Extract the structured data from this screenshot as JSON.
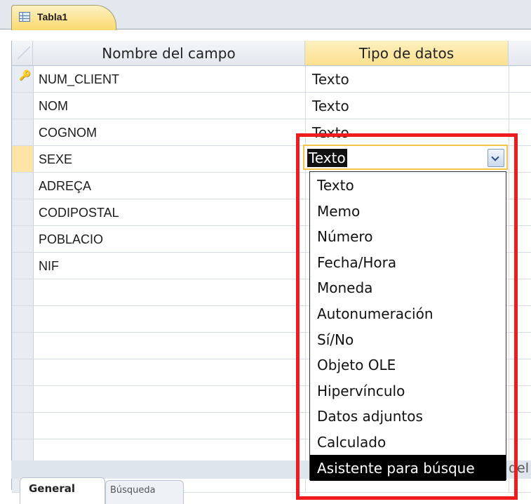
{
  "tab": {
    "label": "Tabla1",
    "icon": "table-icon"
  },
  "grid": {
    "header": {
      "field_name": "Nombre del campo",
      "data_type": "Tipo de datos"
    },
    "rows": [
      {
        "name": "NUM_CLIENT",
        "type": "Texto",
        "key": true
      },
      {
        "name": "NOM",
        "type": "Texto"
      },
      {
        "name": "COGNOM",
        "type": "Texto"
      },
      {
        "name": "SEXE",
        "type": "Texto",
        "current": true
      },
      {
        "name": "ADREÇA",
        "type": ""
      },
      {
        "name": "CODIPOSTAL",
        "type": ""
      },
      {
        "name": "POBLACIO",
        "type": ""
      },
      {
        "name": "NIF",
        "type": ""
      }
    ]
  },
  "combo": {
    "value": "Texto",
    "button_icon": "chevron-down-icon"
  },
  "dropdown": {
    "options": [
      "Texto",
      "Memo",
      "Número",
      "Fecha/Hora",
      "Moneda",
      "Autonumeración",
      "Sí/No",
      "Objeto OLE",
      "Hipervínculo",
      "Datos adjuntos",
      "Calculado",
      "Asistente para búsque"
    ],
    "highlighted": "Asistente para búsque"
  },
  "lower": {
    "general_tab": "General",
    "lookup_tab": "Búsqueda",
    "partial": "del"
  },
  "colors": {
    "highlight_border": "#ee1c1c",
    "header_selected": "#fbe08f",
    "current_row": "#fde6a5"
  }
}
